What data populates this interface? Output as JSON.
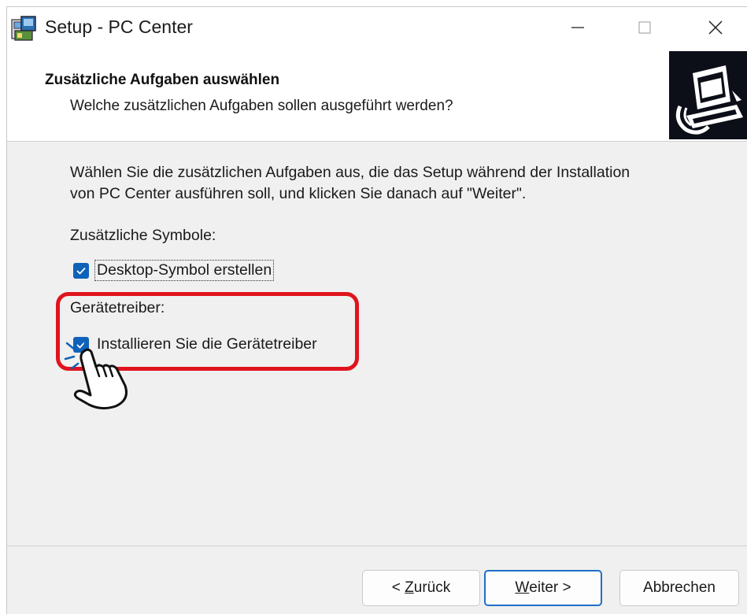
{
  "window": {
    "title": "Setup - PC Center"
  },
  "header": {
    "title": "Zusätzliche Aufgaben auswählen",
    "subtitle": "Welche zusätzlichen Aufgaben sollen ausgeführt werden?"
  },
  "content": {
    "intro_line1": "Wählen Sie die zusätzlichen Aufgaben aus, die das Setup während der Installation",
    "intro_line2": "von PC Center ausführen soll, und klicken Sie danach auf \"Weiter\".",
    "group1_label": "Zusätzliche Symbole:",
    "task1_label": "Desktop-Symbol erstellen",
    "task1_checked": true,
    "group2_label": "Gerätetreiber:",
    "task2_label": "Installieren Sie die Gerätetreiber",
    "task2_checked": true
  },
  "buttons": {
    "back_prefix": "< ",
    "back_key": "Z",
    "back_rest": "urück",
    "next_key": "W",
    "next_rest": "eiter >",
    "cancel": "Abbrechen"
  },
  "colors": {
    "highlight": "#e0141e",
    "checkbox": "#0f62b8",
    "default_button_border": "#1f6fc4"
  }
}
